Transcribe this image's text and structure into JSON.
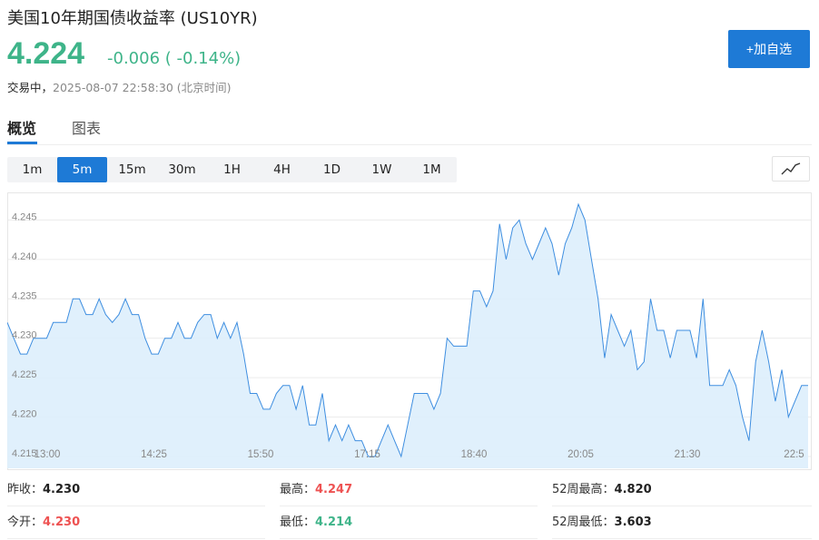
{
  "header": {
    "title": "美国10年期国债收益率 (US10YR)",
    "price": "4.224",
    "change": "-0.006 ( -0.14%)",
    "status": "交易中，",
    "timestamp": "2025-08-07 22:58:30 (北京时间)",
    "add_watchlist_label": "+加自选"
  },
  "tabs": [
    {
      "label": "概览",
      "active": true
    },
    {
      "label": "图表",
      "active": false
    }
  ],
  "periods": [
    {
      "label": "1m",
      "active": false
    },
    {
      "label": "5m",
      "active": true
    },
    {
      "label": "15m",
      "active": false
    },
    {
      "label": "30m",
      "active": false
    },
    {
      "label": "1H",
      "active": false
    },
    {
      "label": "4H",
      "active": false
    },
    {
      "label": "1D",
      "active": false
    },
    {
      "label": "1W",
      "active": false
    },
    {
      "label": "1M",
      "active": false
    }
  ],
  "chart_type_icon": "line-chart-icon",
  "colors": {
    "up": "#ee5252",
    "down": "#3eb489",
    "accent": "#1e7ad6",
    "line": "#3e8ee0",
    "fill": "#ddeefc"
  },
  "chart_data": {
    "type": "area",
    "title": "",
    "xlabel": "",
    "ylabel": "",
    "x_ticks": [
      "13:00",
      "14:25",
      "15:50",
      "17:15",
      "18:40",
      "20:05",
      "21:30",
      "22:5"
    ],
    "y_ticks": [
      "4.215",
      "4.220",
      "4.225",
      "4.230",
      "4.235",
      "4.240",
      "4.245"
    ],
    "ylim": [
      4.2135,
      4.2485
    ],
    "grid": true,
    "values": [
      4.232,
      4.23,
      4.228,
      4.228,
      4.23,
      4.23,
      4.23,
      4.232,
      4.232,
      4.232,
      4.235,
      4.235,
      4.233,
      4.233,
      4.235,
      4.233,
      4.232,
      4.233,
      4.235,
      4.233,
      4.233,
      4.23,
      4.228,
      4.228,
      4.23,
      4.23,
      4.232,
      4.23,
      4.23,
      4.232,
      4.233,
      4.233,
      4.23,
      4.232,
      4.23,
      4.232,
      4.228,
      4.223,
      4.223,
      4.221,
      4.221,
      4.223,
      4.224,
      4.224,
      4.221,
      4.224,
      4.219,
      4.219,
      4.223,
      4.217,
      4.219,
      4.217,
      4.219,
      4.217,
      4.217,
      4.215,
      4.215,
      4.217,
      4.219,
      4.217,
      4.215,
      4.219,
      4.223,
      4.223,
      4.223,
      4.221,
      4.223,
      4.23,
      4.229,
      4.229,
      4.229,
      4.236,
      4.236,
      4.234,
      4.236,
      4.2445,
      4.24,
      4.244,
      4.245,
      4.242,
      4.24,
      4.242,
      4.244,
      4.242,
      4.238,
      4.242,
      4.244,
      4.247,
      4.245,
      4.24,
      4.235,
      4.2275,
      4.233,
      4.231,
      4.229,
      4.231,
      4.226,
      4.227,
      4.235,
      4.231,
      4.231,
      4.2275,
      4.231,
      4.231,
      4.231,
      4.2275,
      4.235,
      4.224,
      4.224,
      4.224,
      4.226,
      4.224,
      4.22,
      4.217,
      4.227,
      4.231,
      4.227,
      4.222,
      4.226,
      4.22,
      4.222,
      4.224,
      4.224
    ]
  },
  "stats": [
    {
      "label": "昨收：",
      "value": "4.230",
      "color": ""
    },
    {
      "label": "最高：",
      "value": "4.247",
      "color": "red"
    },
    {
      "label": "52周最高：",
      "value": "4.820",
      "color": ""
    },
    {
      "label": "今开：",
      "value": "4.230",
      "color": "red"
    },
    {
      "label": "最低：",
      "value": "4.214",
      "color": "green"
    },
    {
      "label": "52周最低：",
      "value": "3.603",
      "color": ""
    }
  ]
}
